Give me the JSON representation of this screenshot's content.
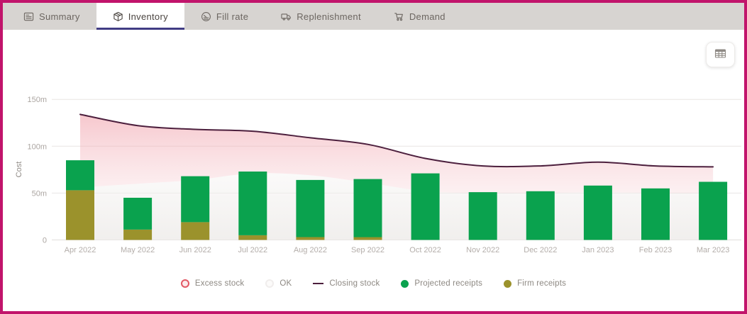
{
  "page": {
    "border_color": "#c1146b",
    "tabbar_bg": "#d7d4d1",
    "active_tab_underline": "#413d84"
  },
  "tabs": [
    {
      "label": "Summary",
      "icon": "summary-list-icon",
      "active": false
    },
    {
      "label": "Inventory",
      "icon": "inventory-box-icon",
      "active": true
    },
    {
      "label": "Fill rate",
      "icon": "fill-rate-gauge-icon",
      "active": false
    },
    {
      "label": "Replenishment",
      "icon": "replenishment-truck-icon",
      "active": false
    },
    {
      "label": "Demand",
      "icon": "demand-cart-icon",
      "active": false
    }
  ],
  "toolbar": {
    "table_view_icon": "table-grid-icon"
  },
  "chart_data": {
    "type": "combo: stacked bars + smoothed line + shaded areas",
    "title": "",
    "xlabel": "",
    "ylabel": "Cost",
    "unit": "m",
    "ylim": [
      0,
      150
    ],
    "yticks": [
      {
        "value": 150,
        "label": "150m"
      },
      {
        "value": 100,
        "label": "100m"
      },
      {
        "value": 50,
        "label": "50m"
      },
      {
        "value": 0,
        "label": "0"
      }
    ],
    "categories": [
      "Apr 2022",
      "May 2022",
      "Jun 2022",
      "Jul 2022",
      "Aug 2022",
      "Sep 2022",
      "Oct 2022",
      "Nov 2022",
      "Dec 2022",
      "Jan 2023",
      "Feb 2023",
      "Mar 2023"
    ],
    "series": [
      {
        "name": "Projected receipts",
        "type": "bar",
        "color": "#0aa24e",
        "values": [
          32,
          34,
          49,
          68,
          61,
          62,
          71,
          51,
          52,
          58,
          55,
          62
        ]
      },
      {
        "name": "Firm receipts",
        "type": "bar",
        "color": "#9b922c",
        "values": [
          53,
          11,
          19,
          5,
          3,
          3,
          0,
          0,
          0,
          0,
          0,
          0
        ]
      },
      {
        "name": "Closing stock",
        "type": "line",
        "color": "#4c1f3d",
        "values": [
          134,
          122,
          118,
          116,
          109,
          102,
          87,
          79,
          79,
          83,
          79,
          78
        ]
      },
      {
        "name": "OK",
        "type": "area",
        "color": "#f0edeb",
        "values": [
          56,
          60,
          64,
          71,
          69,
          61,
          52,
          50,
          50,
          51,
          50,
          50
        ]
      },
      {
        "name": "Excess stock",
        "type": "area-band-between-ok-and-closing",
        "color": "#f09aa5"
      }
    ],
    "grid": true,
    "legend_position": "bottom"
  },
  "legend": [
    {
      "label": "Excess stock",
      "marker": "ring",
      "color": "#e25864",
      "fill": "#fce9eb"
    },
    {
      "label": "OK",
      "marker": "ring",
      "color": "#f0edec",
      "fill": "#fcfbfa"
    },
    {
      "label": "Closing stock",
      "marker": "line",
      "color": "#4c1f3d",
      "fill": "#4c1f3d"
    },
    {
      "label": "Projected receipts",
      "marker": "dot",
      "color": "#0aa24e",
      "fill": "#0aa24e"
    },
    {
      "label": "Firm receipts",
      "marker": "dot",
      "color": "#9b922c",
      "fill": "#9b922c"
    }
  ]
}
